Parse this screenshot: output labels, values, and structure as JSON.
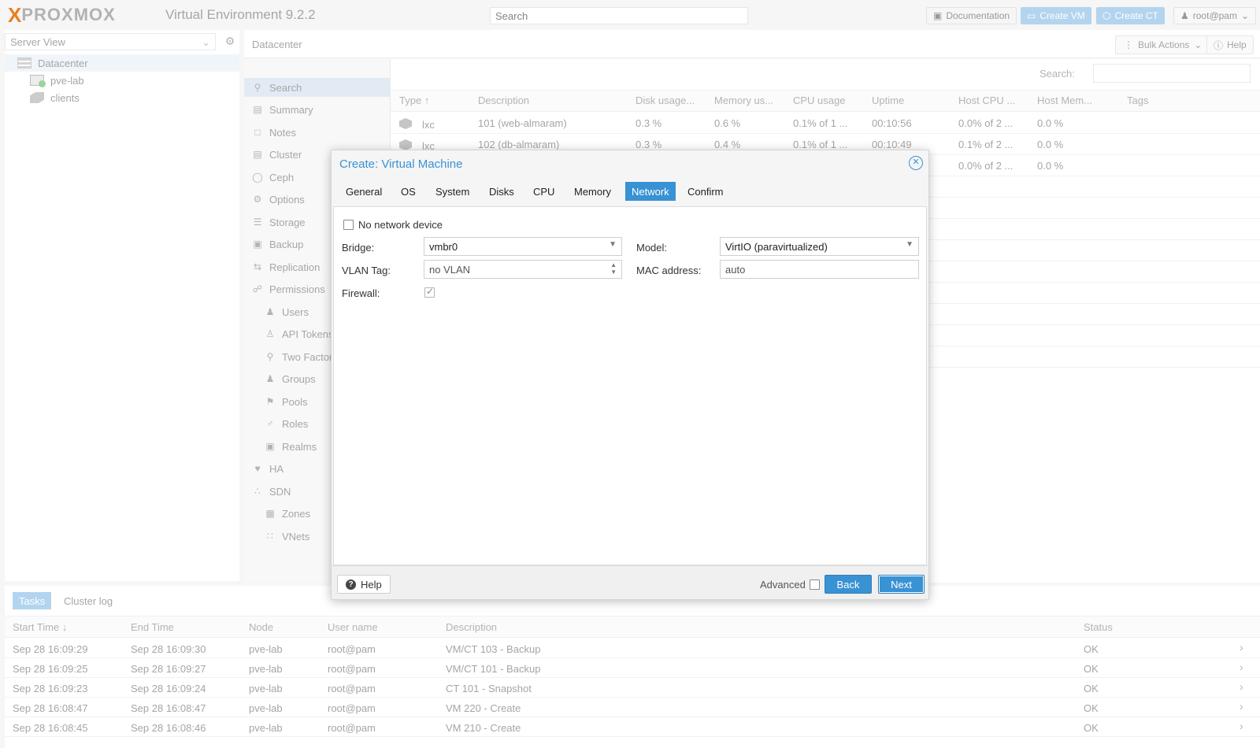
{
  "topbar": {
    "logo_x": "X",
    "logo_word": "PROXMOX",
    "app_title": "Virtual Environment 9.2.2",
    "search_placeholder": "Search",
    "documentation": "Documentation",
    "create_vm": "Create VM",
    "create_ct": "Create CT",
    "user": "root@pam"
  },
  "tree": {
    "view": "Server View",
    "items": [
      {
        "label": "Datacenter"
      },
      {
        "label": "pve-lab"
      },
      {
        "label": "clients"
      }
    ]
  },
  "content": {
    "breadcrumb": "Datacenter",
    "bulk_actions": "Bulk Actions",
    "help": "Help",
    "search_label": "Search:",
    "nav": [
      {
        "label": "Search"
      },
      {
        "label": "Summary"
      },
      {
        "label": "Notes"
      },
      {
        "label": "Cluster"
      },
      {
        "label": "Ceph"
      },
      {
        "label": "Options"
      },
      {
        "label": "Storage"
      },
      {
        "label": "Backup"
      },
      {
        "label": "Replication"
      },
      {
        "label": "Permissions"
      },
      {
        "label": "Users"
      },
      {
        "label": "API Tokens"
      },
      {
        "label": "Two Factor"
      },
      {
        "label": "Groups"
      },
      {
        "label": "Pools"
      },
      {
        "label": "Roles"
      },
      {
        "label": "Realms"
      },
      {
        "label": "HA"
      },
      {
        "label": "SDN"
      },
      {
        "label": "Zones"
      },
      {
        "label": "VNets"
      }
    ],
    "grid_columns": [
      "Type",
      "Description",
      "Disk usage...",
      "Memory us...",
      "CPU usage",
      "Uptime",
      "Host CPU ...",
      "Host Mem...",
      "Tags"
    ],
    "grid_rows": [
      [
        "lxc",
        "101 (web-almaram)",
        "0.3 %",
        "0.6 %",
        "0.1% of 1 ...",
        "00:10:56",
        "0.0% of 2 ...",
        "0.0 %"
      ],
      [
        "lxc",
        "102 (db-almaram)",
        "0.3 %",
        "0.4 %",
        "0.1% of 1 ...",
        "00:10:49",
        "0.1% of 2 ...",
        "0.0 %"
      ],
      [
        "",
        "",
        "",
        "",
        "",
        "",
        "0.0% of 2 ...",
        "0.0 %"
      ]
    ]
  },
  "tasks": {
    "tab_tasks": "Tasks",
    "tab_cluster_log": "Cluster log",
    "columns": [
      "Start Time",
      "End Time",
      "Node",
      "User name",
      "Description",
      "Status"
    ],
    "rows": [
      [
        "Sep 28 16:09:29",
        "Sep 28 16:09:30",
        "pve-lab",
        "root@pam",
        "VM/CT 103 - Backup",
        "OK"
      ],
      [
        "Sep 28 16:09:25",
        "Sep 28 16:09:27",
        "pve-lab",
        "root@pam",
        "VM/CT 101 - Backup",
        "OK"
      ],
      [
        "Sep 28 16:09:23",
        "Sep 28 16:09:24",
        "pve-lab",
        "root@pam",
        "CT 101 - Snapshot",
        "OK"
      ],
      [
        "Sep 28 16:08:47",
        "Sep 28 16:08:47",
        "pve-lab",
        "root@pam",
        "VM 220 - Create",
        "OK"
      ],
      [
        "Sep 28 16:08:45",
        "Sep 28 16:08:46",
        "pve-lab",
        "root@pam",
        "VM 210 - Create",
        "OK"
      ]
    ]
  },
  "dialog": {
    "title": "Create: Virtual Machine",
    "tabs": [
      "General",
      "OS",
      "System",
      "Disks",
      "CPU",
      "Memory",
      "Network",
      "Confirm"
    ],
    "active_tab": "Network",
    "no_network_device": "No network device",
    "bridge_label": "Bridge:",
    "bridge_value": "vmbr0",
    "vlan_label": "VLAN Tag:",
    "vlan_value": "no VLAN",
    "firewall_label": "Firewall:",
    "firewall_checked": true,
    "model_label": "Model:",
    "model_value": "VirtIO (paravirtualized)",
    "mac_label": "MAC address:",
    "mac_value": "auto",
    "help": "Help",
    "advanced": "Advanced",
    "back": "Back",
    "next": "Next"
  },
  "colors": {
    "accent": "#3892d4",
    "accent_faded": "#a9cfec",
    "brand_orange": "#e57000"
  }
}
